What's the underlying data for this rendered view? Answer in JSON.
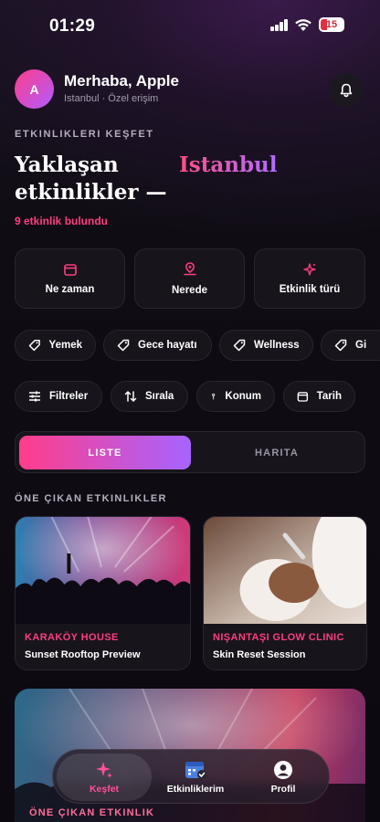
{
  "status": {
    "time": "01:29",
    "battery": "15"
  },
  "header": {
    "avatar_initial": "A",
    "greeting": "Merhaba, Apple",
    "subline": "Istanbul · Özel erişim"
  },
  "hero": {
    "eyebrow": "ETKINLIKLERI KEŞFET",
    "headline": "Yaklaşan etkinlikler —",
    "city": "Istanbul",
    "count": "9 etkinlik bulundu"
  },
  "filter_cards": [
    {
      "label": "Ne zaman",
      "icon": "calendar-icon"
    },
    {
      "label": "Nerede",
      "icon": "location-pin-icon"
    },
    {
      "label": "Etkinlik türü",
      "icon": "sparkle-icon"
    }
  ],
  "categories": [
    {
      "label": "Yemek",
      "icon": "tag-icon"
    },
    {
      "label": "Gece hayatı",
      "icon": "tag-icon"
    },
    {
      "label": "Wellness",
      "icon": "tag-icon"
    },
    {
      "label": "Gi",
      "icon": "tag-icon"
    }
  ],
  "tools": [
    {
      "label": "Filtreler",
      "icon": "sliders-icon"
    },
    {
      "label": "Sırala",
      "icon": "sort-icon"
    },
    {
      "label": "Konum",
      "icon": "pin-icon"
    },
    {
      "label": "Tarih",
      "icon": "calendar-icon"
    }
  ],
  "view_toggle": {
    "active": "LISTE",
    "inactive": "HARITA"
  },
  "featured": {
    "title": "ÖNE ÇIKAN ETKINLIKLER",
    "events": [
      {
        "venue": "KARAKÖY HOUSE",
        "name": "Sunset Rooftop Preview"
      },
      {
        "venue": "NIŞANTAŞI GLOW CLINIC",
        "name": "Skin Reset Session"
      }
    ],
    "big_card_eyebrow": "ÖNE ÇIKAN ETKINLIK"
  },
  "tab_bar": [
    {
      "label": "Keşfet",
      "icon": "sparkle-icon",
      "active": true
    },
    {
      "label": "Etkinliklerim",
      "icon": "calendar-check-icon",
      "active": false
    },
    {
      "label": "Profil",
      "icon": "user-icon",
      "active": false
    }
  ],
  "colors": {
    "accent_pink": "#ff3d7f",
    "accent_purple": "#a664ff",
    "background": "#0e0b12",
    "card": "#17141b"
  }
}
